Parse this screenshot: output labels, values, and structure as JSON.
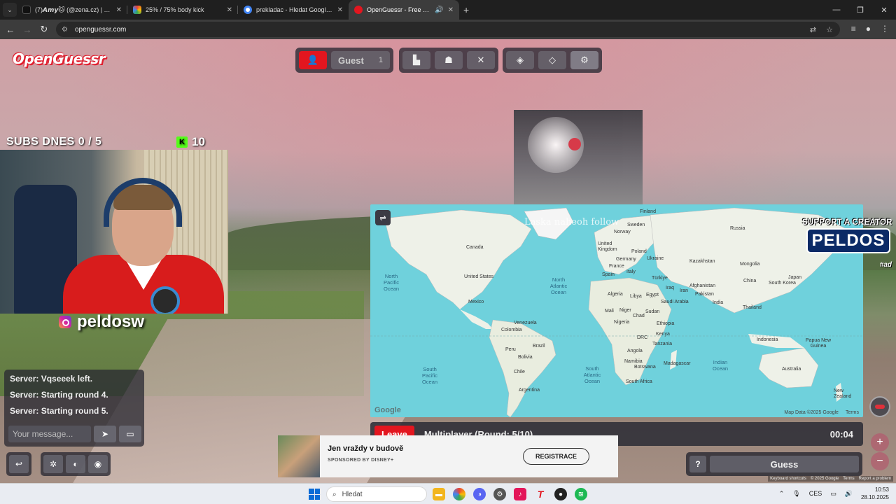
{
  "browser": {
    "tabs": [
      {
        "title": "(7)𝘼𝙢𝙮🐱 (@zena.cz) | TikTok",
        "favicon_color": "#111111",
        "active": false
      },
      {
        "title": "25% / 75% body kick",
        "favicon_color": "#4285f4",
        "active": false
      },
      {
        "title": "prekladac - Hledat Googlem",
        "favicon_color": "#34a853",
        "active": false
      },
      {
        "title": "OpenGuessr - Free GeoGuessr",
        "favicon_color": "#e3161f",
        "active": true
      }
    ],
    "url": "openguessr.com"
  },
  "game": {
    "brand": "OpenGuessr",
    "toolbar": {
      "player_name": "Guest",
      "player_count": "1"
    },
    "overlay": {
      "subs_text": "SUBS DNES  0 / 5",
      "kick_count": "10",
      "instagram_handle": "peldosw",
      "follow_text": "Laska naheoh follow",
      "support_line1": "SUPPORT A CREATOR",
      "support_line2": "PELDOS",
      "support_line3": "#ad"
    },
    "map": {
      "labels": {
        "canada": "Canada",
        "united_states": "United States",
        "mexico": "Mexico",
        "venezuela": "Venezuela",
        "colombia": "Colombia",
        "peru": "Peru",
        "brazil": "Brazil",
        "bolivia": "Bolivia",
        "chile": "Chile",
        "argentina": "Argentina",
        "north_pacific": "North Pacific Ocean",
        "north_atlantic": "North Atlantic Ocean",
        "south_pacific": "South Pacific Ocean",
        "south_atlantic": "South Atlantic Ocean",
        "indian_ocean": "Indian Ocean",
        "norway": "Norway",
        "finland": "Finland",
        "sweden": "Sweden",
        "united_kingdom": "United Kingdom",
        "poland": "Poland",
        "germany": "Germany",
        "ukraine": "Ukraine",
        "france": "France",
        "spain": "Spain",
        "italy": "Italy",
        "turkiye": "Türkiye",
        "russia": "Russia",
        "kazakhstan": "Kazakhstan",
        "mongolia": "Mongolia",
        "china": "China",
        "south_korea": "South Korea",
        "japan": "Japan",
        "afghanistan": "Afghanistan",
        "pakistan": "Pakistan",
        "india": "India",
        "iraq": "Iraq",
        "iran": "Iran",
        "saudi_arabia": "Saudi Arabia",
        "thailand": "Thailand",
        "algeria": "Algeria",
        "libya": "Libya",
        "egypt": "Egypt",
        "mali": "Mali",
        "niger": "Niger",
        "chad": "Chad",
        "sudan": "Sudan",
        "nigeria": "Nigeria",
        "ethiopia": "Ethiopia",
        "drc": "DRC",
        "kenya": "Kenya",
        "tanzania": "Tanzania",
        "angola": "Angola",
        "namibia": "Namibia",
        "botswana": "Botswana",
        "madagascar": "Madagascar",
        "south_africa": "South Africa",
        "indonesia": "Indonesia",
        "papua": "Papua New Guinea",
        "australia": "Australia",
        "new_zealand": "New Zealand"
      },
      "google": "Google",
      "map_data": "Map Data ©2025 Google",
      "terms": "Terms"
    },
    "status": {
      "leave_label": "Leave",
      "round_text": "Multiplayer (Round: 5/10)",
      "timer": "00:04"
    },
    "chat": {
      "messages": [
        "Server: Vqseeek left.",
        "Server: Starting round 4.",
        "Server: Starting round 5."
      ],
      "placeholder": "Your message..."
    },
    "ad": {
      "title": "Jen vraždy v budově",
      "sponsor": "SPONSORED BY DISNEY+",
      "cta": "REGISTRACE"
    },
    "guess": {
      "help": "?",
      "label": "Guess"
    },
    "footer": {
      "shortcuts": "Keyboard shortcuts",
      "copyright": "© 2025 Google",
      "terms": "Terms",
      "report": "Report a problem"
    }
  },
  "taskbar": {
    "search_placeholder": "Hledat",
    "lang": "CES",
    "time": "10:53",
    "date": "28.10.2025"
  }
}
